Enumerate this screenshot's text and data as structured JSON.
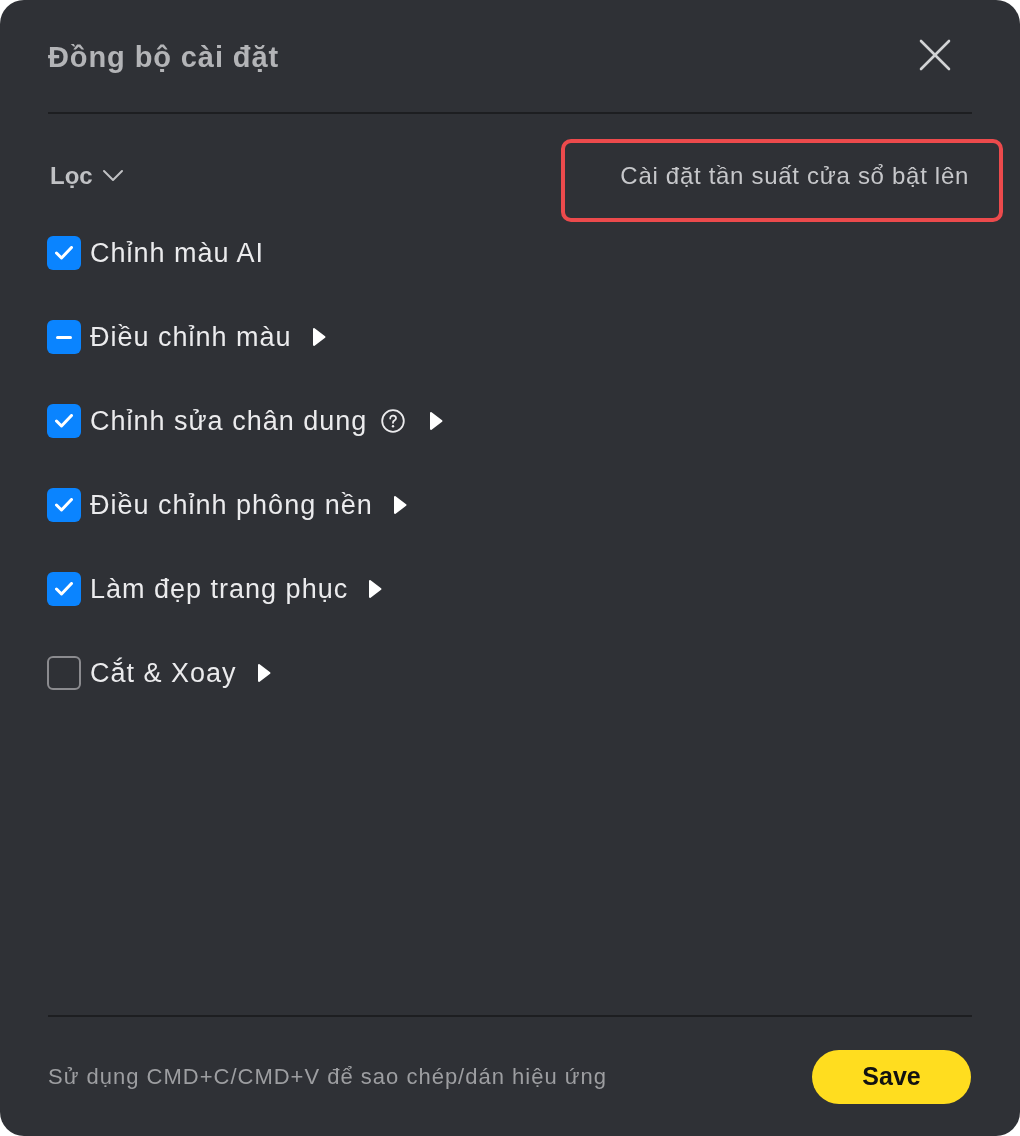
{
  "dialog": {
    "title": "Đồng bộ cài đặt"
  },
  "filter": {
    "label": "Lọc"
  },
  "popup_frequency_link": {
    "label": "Cài đặt tần suất cửa sổ bật lên",
    "highlighted": true
  },
  "options": [
    {
      "label": "Chỉnh màu AI",
      "checked": true,
      "partial": false,
      "help": false,
      "expandable": false
    },
    {
      "label": "Điều chỉnh màu",
      "checked": true,
      "partial": true,
      "help": false,
      "expandable": true
    },
    {
      "label": "Chỉnh sửa chân dung",
      "checked": true,
      "partial": false,
      "help": true,
      "expandable": true
    },
    {
      "label": "Điều chỉnh phông nền",
      "checked": true,
      "partial": false,
      "help": false,
      "expandable": true
    },
    {
      "label": "Làm đẹp trang phục",
      "checked": true,
      "partial": false,
      "help": false,
      "expandable": true
    },
    {
      "label": "Cắt & Xoay",
      "checked": false,
      "partial": false,
      "help": false,
      "expandable": true
    }
  ],
  "footer": {
    "hint": "Sử dụng CMD+C/CMD+V để sao chép/dán hiệu ứng",
    "buttons": [
      "Save"
    ]
  }
}
